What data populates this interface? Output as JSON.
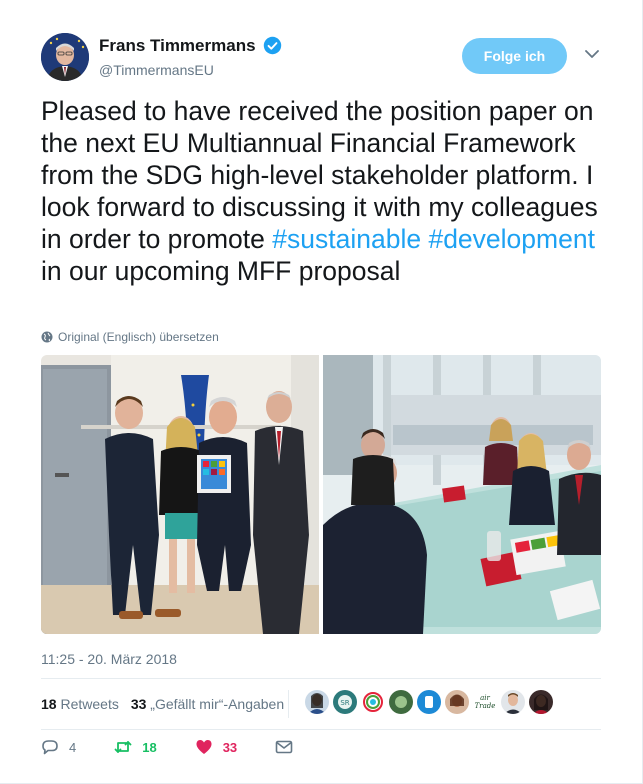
{
  "author": {
    "name": "Frans Timmermans",
    "handle": "@TimmermansEU",
    "verified": true,
    "avatar_icon": "profile-photo"
  },
  "follow_button_label": "Folge ich",
  "tweet": {
    "text_before": "Pleased to have received the position paper on the next EU Multiannual Financial Framework from the SDG high-level stakeholder platform. I look forward to discussing it with my colleagues in order to promote ",
    "hashtag_1": "#sustainable",
    "space": " ",
    "hashtag_2": "#development",
    "text_after": " in our upcoming MFF proposal"
  },
  "translate_label": "Original (Englisch) übersetzen",
  "timestamp": "11:25 - 20. März 2018",
  "stats": {
    "retweets_count": "18",
    "retweets_label": "Retweets",
    "likes_count": "33",
    "likes_label": "„Gefällt mir“-Angaben"
  },
  "actions": {
    "reply_count": "4",
    "retweet_count": "18",
    "like_count": "33"
  },
  "colors": {
    "link": "#1da1f2",
    "follow_button": "#71c9f8",
    "retweet": "#17bf63",
    "like": "#e0245e",
    "muted": "#657786"
  }
}
